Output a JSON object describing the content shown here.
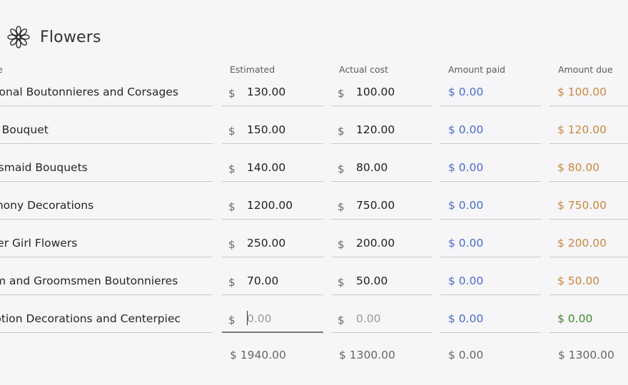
{
  "header": {
    "title": "Flowers",
    "icon": "flower-icon"
  },
  "columns": {
    "name": "e",
    "estimated": "Estimated",
    "actual": "Actual cost",
    "paid": "Amount paid",
    "due": "Amount due"
  },
  "currency": "$",
  "rows": [
    {
      "name": "ditional Boutonnieres and Corsages",
      "estimated": "130.00",
      "actual": "100.00",
      "paid": "$ 0.00",
      "due": "$ 100.00"
    },
    {
      "name": "ide Bouquet",
      "estimated": "150.00",
      "actual": "120.00",
      "paid": "$ 0.00",
      "due": "$ 120.00"
    },
    {
      "name": "idesmaid Bouquets",
      "estimated": "140.00",
      "actual": "80.00",
      "paid": "$ 0.00",
      "due": "$ 80.00"
    },
    {
      "name": "remony Decorations",
      "estimated": "1200.00",
      "actual": "750.00",
      "paid": "$ 0.00",
      "due": "$ 750.00"
    },
    {
      "name": "ower Girl Flowers",
      "estimated": "250.00",
      "actual": "200.00",
      "paid": "$ 0.00",
      "due": "$ 200.00"
    },
    {
      "name": "oom and Groomsmen Boutonnieres",
      "estimated": "70.00",
      "actual": "50.00",
      "paid": "$ 0.00",
      "due": "$ 50.00"
    },
    {
      "name": "ception Decorations and Centerpiec",
      "estimated_placeholder": "0.00",
      "actual_placeholder": "0.00",
      "paid": "$ 0.00",
      "due": "$ 0.00"
    }
  ],
  "totals": {
    "estimated": "$ 1940.00",
    "actual": "$ 1300.00",
    "paid": "$ 0.00",
    "due": "$ 1300.00"
  },
  "colors": {
    "paid": "#4a6cc9",
    "due": "#c7893d",
    "due_zero": "#3e8a2a"
  }
}
